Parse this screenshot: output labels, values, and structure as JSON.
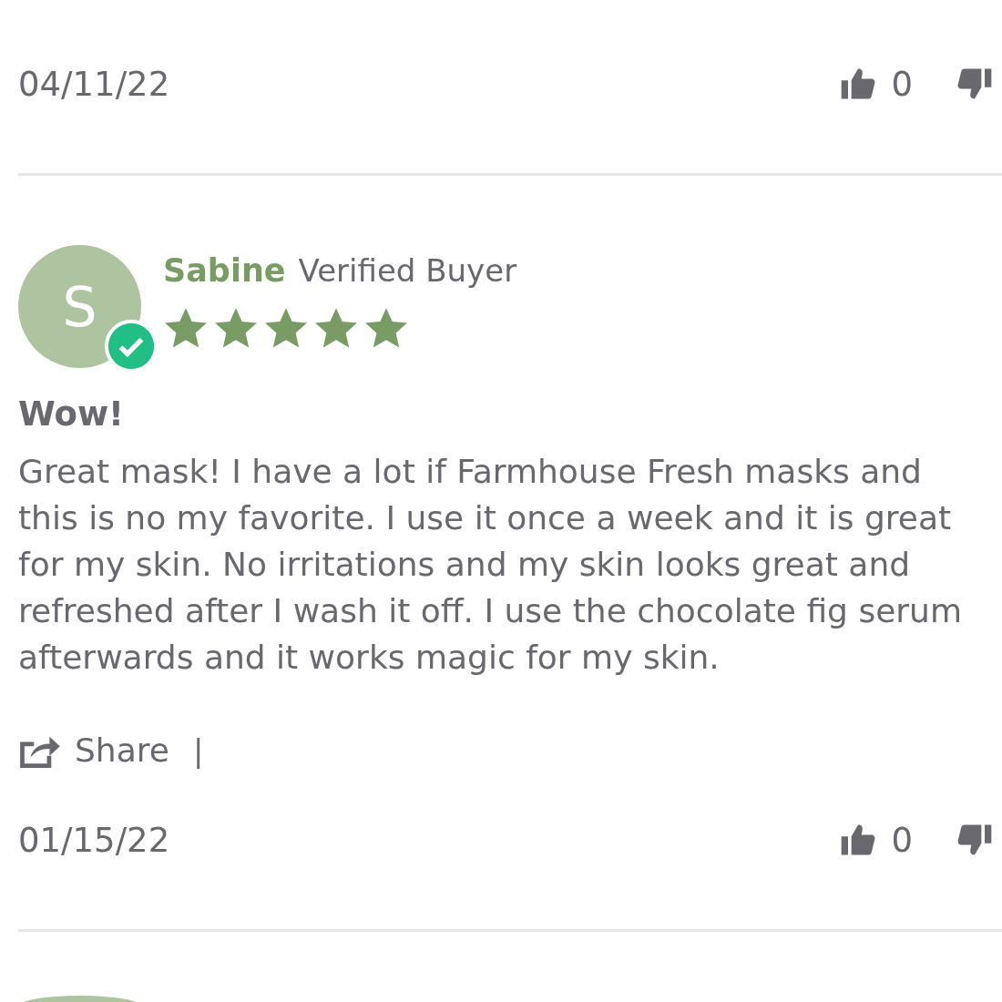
{
  "previous_review": {
    "date": "04/11/22",
    "helpful_count": "0"
  },
  "reviews": [
    {
      "initial": "S",
      "name": "Sabine",
      "badge": "Verified Buyer",
      "verified": true,
      "stars": 5,
      "title": "Wow!",
      "body": "Great mask! I have a lot if Farmhouse Fresh masks and this is no my favorite. I use it once a week and it is great for my skin. No irritations and my skin looks great and refreshed after I wash it off. I use the chocolate fig serum afterwards and it works magic for my skin.",
      "share_label": "Share",
      "separator": "|",
      "date": "01/15/22",
      "helpful_count": "0"
    }
  ]
}
